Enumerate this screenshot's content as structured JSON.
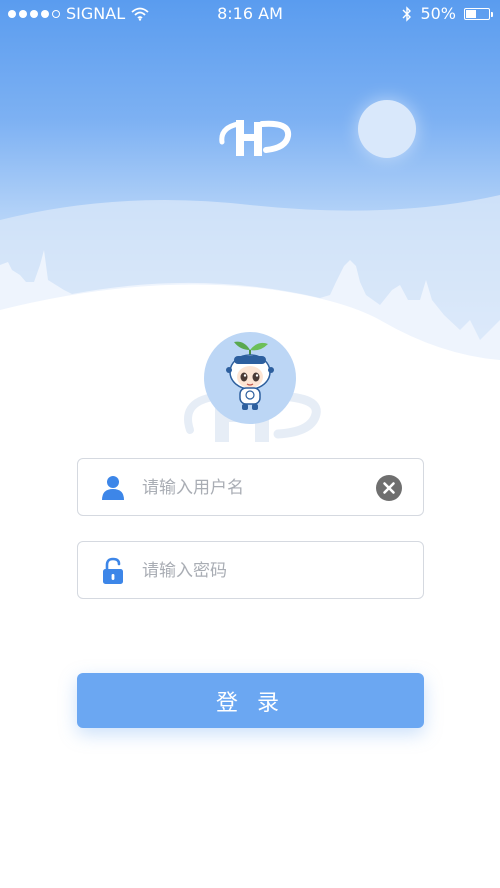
{
  "status_bar": {
    "carrier": "SIGNAL",
    "time": "8:16 AM",
    "battery": "50%",
    "battery_level": 0.5,
    "icons": [
      "signal-dots-icon",
      "wifi-icon",
      "bluetooth-icon",
      "battery-icon"
    ]
  },
  "header": {
    "logo_icon": "hp-logo-icon",
    "moon_icon": "moon-icon"
  },
  "avatar": {
    "icon": "mascot-avatar"
  },
  "login_form": {
    "username_placeholder": "请输入用户名",
    "username_value": "",
    "password_placeholder": "请输入密码",
    "password_value": "",
    "username_icon": "user-icon",
    "password_icon": "unlock-icon",
    "clear_icon": "clear-icon"
  },
  "actions": {
    "login_label": "登 录"
  },
  "colors": {
    "sky_top": "#5a9cef",
    "button": "#6ba7f2",
    "icon_blue": "#3d86e8",
    "clear_gray": "#6f6f6f"
  }
}
